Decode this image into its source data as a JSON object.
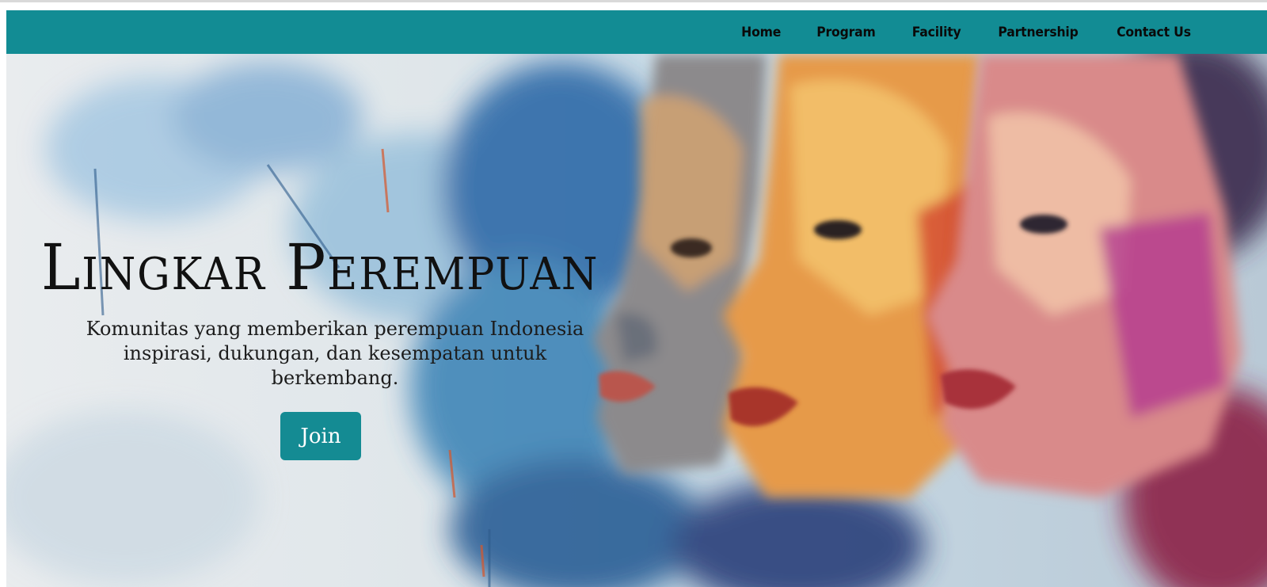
{
  "nav": {
    "items": [
      {
        "label": "Home"
      },
      {
        "label": "Program"
      },
      {
        "label": "Facility"
      },
      {
        "label": "Partnership"
      },
      {
        "label": "Contact Us"
      }
    ]
  },
  "hero": {
    "title": "Lingkar Perempuan",
    "subtitle_line1": "Komunitas yang memberikan perempuan Indonesia",
    "subtitle_line2": "inspirasi, dukungan, dan kesempatan untuk berkembang.",
    "join_label": "Join"
  },
  "colors": {
    "accent": "#128c94",
    "button": "#148b93"
  }
}
